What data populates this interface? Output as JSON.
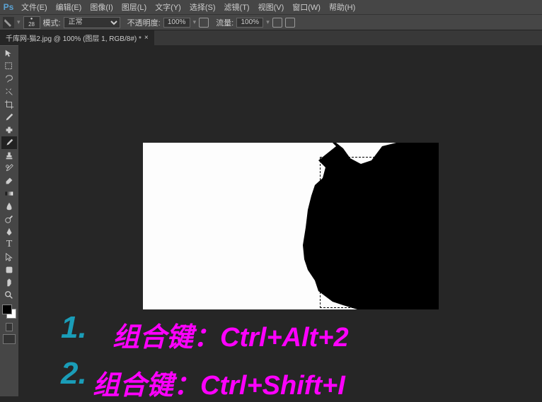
{
  "menubar": {
    "logo": "Ps",
    "items": [
      "文件(E)",
      "编辑(E)",
      "图像(I)",
      "图层(L)",
      "文字(Y)",
      "选择(S)",
      "滤镜(T)",
      "视图(V)",
      "窗口(W)",
      "帮助(H)"
    ]
  },
  "optionsbar": {
    "brush_size": "28",
    "mode_label": "模式:",
    "mode_value": "正常",
    "opacity_label": "不透明度:",
    "opacity_value": "100%",
    "flow_label": "流量:",
    "flow_value": "100%"
  },
  "tab": {
    "title": "千库网-猫2.jpg @ 100% (图层 1, RGB/8#) *",
    "close": "×"
  },
  "tools": [
    "move-tool",
    "marquee-tool",
    "lasso-tool",
    "wand-tool",
    "crop-tool",
    "eyedropper-tool",
    "heal-tool",
    "brush-tool",
    "stamp-tool",
    "history-brush-tool",
    "eraser-tool",
    "gradient-tool",
    "blur-tool",
    "dodge-tool",
    "pen-tool",
    "type-tool",
    "path-select-tool",
    "shape-tool",
    "hand-tool",
    "zoom-tool"
  ],
  "overlay": {
    "num1": "1.",
    "shortcut1": "组合键：Ctrl+Alt+2",
    "num2": "2.",
    "shortcut2": "组合键：Ctrl+Shift+I"
  }
}
